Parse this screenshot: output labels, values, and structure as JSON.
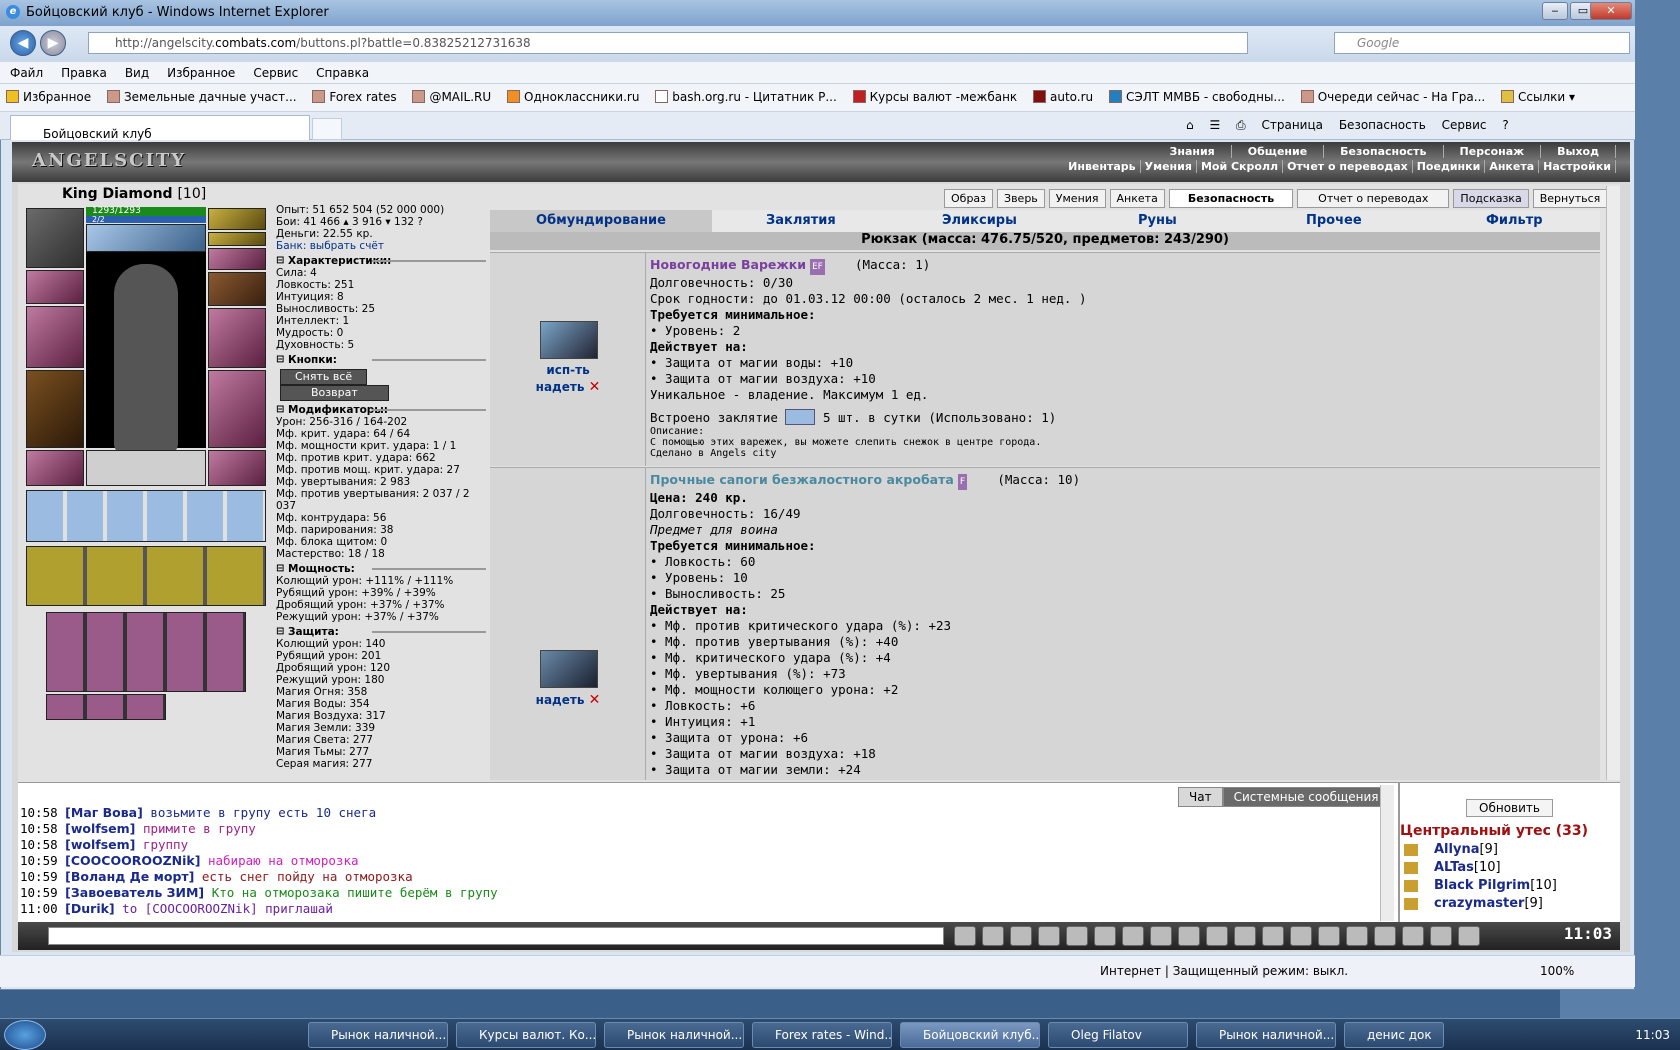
{
  "window": {
    "title": "Бойцовский клуб - Windows Internet Explorer",
    "min": "‒",
    "max": "▭",
    "close": "✕"
  },
  "address": {
    "prefix": "http://angelscity.",
    "domain": "combats.com",
    "path": "/buttons.pl?battle=0.83825212731638"
  },
  "search": {
    "placeholder": "Google"
  },
  "menu": [
    "Файл",
    "Правка",
    "Вид",
    "Избранное",
    "Сервис",
    "Справка"
  ],
  "favorites": {
    "label": "Избранное",
    "items": [
      "Земельные дачные участ...",
      "Forex rates",
      "@MAIL.RU",
      "Одноклассники.ru",
      "bash.org.ru - Цитатник Р...",
      "Курсы валют -межбанк",
      "auto.ru",
      "СЭЛТ ММВБ - свободны...",
      "Очереди сейчас - На Гра...",
      "Ссылки"
    ]
  },
  "tab": {
    "label": "Бойцовский клуб"
  },
  "commandbar": [
    "Страница",
    "Безопасность",
    "Сервис"
  ],
  "game": {
    "logo": "ANGELSCITY",
    "nav1": [
      "Знания",
      "Общение",
      "Безопасность",
      "Персонаж",
      "Выход"
    ],
    "nav2": [
      "Инвентарь",
      "Умения",
      "Мой Скролл",
      "Отчет о переводах",
      "Поединки",
      "Анкета",
      "Настройки"
    ],
    "char": {
      "name": "King Diamond",
      "level": "[10]",
      "hp": "1293/1293",
      "mp": "2/2"
    },
    "stats_top": [
      "Опыт: 51 652 504 (52 000 000)",
      "Бои: 41 466 ▴ 3 916 ▾ 132 ?",
      "Деньги: 22.55 кр.",
      "Банк: выбрать счёт"
    ],
    "sec_char": "Характеристики:",
    "char_stats": [
      "Сила: 4",
      "Ловкость: 251",
      "Интуиция: 8",
      "Выносливость: 25",
      "Интеллект: 1",
      "Мудрость: 0",
      "Духовность: 5"
    ],
    "sec_buttons": "Кнопки:",
    "btn_remove": "Снять всё",
    "btn_return": "Возврат",
    "sec_mods": "Модификаторы:",
    "mods": [
      "Урон: 256-316 / 164-202",
      "Мф. крит. удара: 64 / 64",
      "Мф. мощности крит. удара: 1 / 1",
      "Мф. против крит. удара: 662",
      "Мф. против мощ. крит. удара: 27",
      "Мф. увертывания: 2 983",
      "Мф. против увертывания: 2 037 / 2 037",
      "Мф. контрудара: 56",
      "Мф. парирования: 38",
      "Мф. блока щитом: 0",
      "Мастерство: 18 / 18"
    ],
    "sec_power": "Мощность:",
    "power": [
      "Колющий урон: +111% / +111%",
      "Рубящий урон: +39% / +39%",
      "Дробящий урон: +37% / +37%",
      "Режущий урон: +37% / +37%"
    ],
    "sec_def": "Защита:",
    "defense": [
      "Колющий урон: 140",
      "Рубящий урон: 201",
      "Дробящий урон: 120",
      "Режущий урон: 180",
      "Магия Огня: 358",
      "Магия Воды: 354",
      "Магия Воздуха: 317",
      "Магия Земли: 339",
      "Магия Света: 277",
      "Магия Тьмы: 277",
      "Серая магия: 277"
    ],
    "topbtns": [
      "Образ",
      "Зверь",
      "Умения",
      "Анкета",
      "Безопасность",
      "Отчет о переводах",
      "Подсказка",
      "Вернуться"
    ],
    "invtabs": [
      "Обмундирование",
      "Заклятия",
      "Эликсиры",
      "Руны",
      "Прочее",
      "Фильтр"
    ],
    "rucksack": "Рюкзак (масса: 476.75/520, предметов: 243/290)",
    "item1": {
      "act1": "исп-ть",
      "act2": "надеть",
      "name": "Новогодние Варежки",
      "tag": "EF",
      "mass": "(Масса: 1)",
      "lines": [
        "Долговечность: 0/30",
        "Срок годности: до 01.03.12 00:00 (осталось 2 мес. 1 нед. )"
      ],
      "req_h": "Требуется минимальное:",
      "req": [
        "• Уровень: 2"
      ],
      "act_h": "Действует на:",
      "acts": [
        "• Защита от магии воды: +10",
        "• Защита от магии воздуха: +10"
      ],
      "unique": "Уникальное - владение. Максимум 1 ед.",
      "spell": "Встроено заклятие",
      "spell_tail": "5 шт. в сутки (Использовано: 1)",
      "desc_h": "Описание:",
      "desc": "С помощью этих варежек, вы можете слепить снежок в центре города.",
      "made": "Сделано в Angels city"
    },
    "item2": {
      "act2": "надеть",
      "name": "Прочные сапоги безжалостного акробата",
      "tag": "F",
      "mass": "(Масса: 10)",
      "price": "Цена: 240 кр.",
      "lines": [
        "Долговечность: 16/49"
      ],
      "italic": "Предмет для воина",
      "req_h": "Требуется минимальное:",
      "req": [
        "• Ловкость: 60",
        "• Уровень: 10",
        "• Выносливость: 25"
      ],
      "act_h": "Действует на:",
      "acts": [
        "• Мф. против критического удара (%): +23",
        "• Мф. против увертывания (%): +40",
        "• Мф. критического удара (%): +4",
        "• Мф. увертывания (%): +73",
        "• Мф. мощности колющего урона: +2",
        "• Ловкость: +6",
        "• Интуиция: +1",
        "• Защита от урона: +6",
        "• Защита от магии воздуха: +18",
        "• Защита от магии земли: +24"
      ]
    }
  },
  "chat": {
    "tab_chat": "Чат",
    "tab_sys": "Системные сообщения",
    "lines": [
      {
        "time": "10:58",
        "user": "[Маг Вова]",
        "text": "возьмите в групу есть 10 снега",
        "color": "#1a2a8a"
      },
      {
        "time": "10:58",
        "user": "[wolfsem]",
        "text": "примите в групу",
        "color": "#a0208a"
      },
      {
        "time": "10:58",
        "user": "[wolfsem]",
        "text": "группу",
        "color": "#a0208a"
      },
      {
        "time": "10:59",
        "user": "[COOCOOROOZNik]",
        "text": "набираю на отморозка",
        "color": "#d020c0"
      },
      {
        "time": "10:59",
        "user": "[Воланд Де морт]",
        "text": "есть снег пойду на отморозка",
        "color": "#8a1a1a"
      },
      {
        "time": "10:59",
        "user": "[Завоеватель ЗИМ]",
        "text": "Кто на отморозака пишите берём в групу",
        "color": "#1a8a1a"
      },
      {
        "time": "11:00",
        "user": "[Durik]",
        "text": "to [COOCOOROOZNik] приглашай",
        "color": "#6a20a0"
      }
    ],
    "refresh": "Обновить",
    "location": "Центральный утес (33)",
    "players": [
      {
        "name": "Allyna",
        "lvl": "[9]"
      },
      {
        "name": "ALTas",
        "lvl": "[10]"
      },
      {
        "name": "Black Pilgrim",
        "lvl": "[10]"
      },
      {
        "name": "crazymaster",
        "lvl": "[9]"
      }
    ],
    "clock": "11:03"
  },
  "status": {
    "zone": "Интернет | Защищенный режим: выкл.",
    "zoom": "100%"
  },
  "taskbar": {
    "tasks": [
      "Рынок наличной...",
      "Курсы валют. Ко...",
      "Рынок наличной...",
      "Forex rates - Wind...",
      "Бойцовский клуб...",
      "Oleg Filatov",
      "Рынок наличной...",
      "денис док"
    ],
    "time": "11:03"
  }
}
